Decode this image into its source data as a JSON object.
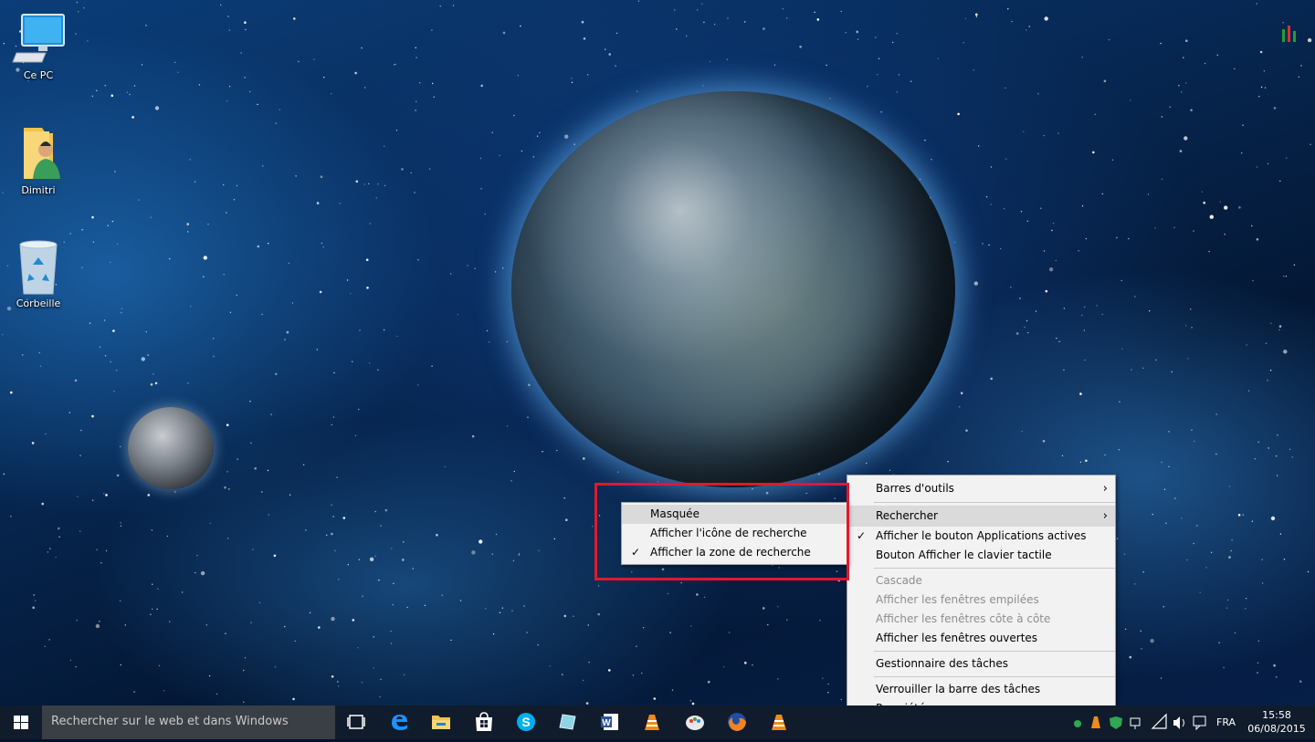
{
  "desktop": {
    "icons": [
      {
        "label": "Ce PC",
        "icon": "computer-icon"
      },
      {
        "label": "Dimitri",
        "icon": "user-folder-icon"
      },
      {
        "label": "Corbeille",
        "icon": "recycle-bin-icon"
      }
    ]
  },
  "taskbar_menu": {
    "items": [
      {
        "label": "Barres d'outils",
        "submenu": true
      },
      {
        "label": "Rechercher",
        "submenu": true,
        "highlighted": true
      },
      {
        "label": "Afficher le bouton Applications actives",
        "checked": true
      },
      {
        "label": "Bouton Afficher le clavier tactile"
      },
      {
        "label": "Cascade",
        "disabled": true
      },
      {
        "label": "Afficher les fenêtres empilées",
        "disabled": true
      },
      {
        "label": "Afficher les fenêtres côte à côte",
        "disabled": true
      },
      {
        "label": "Afficher les fenêtres ouvertes"
      },
      {
        "label": "Gestionnaire des tâches"
      },
      {
        "label": "Verrouiller la barre des tâches"
      },
      {
        "label": "Propriétés"
      }
    ]
  },
  "search_submenu": {
    "items": [
      {
        "label": "Masquée",
        "highlighted": true
      },
      {
        "label": "Afficher l'icône de recherche"
      },
      {
        "label": "Afficher la zone de recherche",
        "checked": true
      }
    ]
  },
  "taskbar": {
    "search_placeholder": "Rechercher sur le web et dans Windows",
    "pinned": [
      "task-view-icon",
      "edge-icon",
      "file-explorer-icon",
      "store-icon",
      "skype-icon",
      "app-icon",
      "word-icon",
      "vlc-icon",
      "paint-icon",
      "firefox-icon",
      "vlc-icon"
    ],
    "language": "FRA",
    "time": "15:58",
    "date": "06/08/2015"
  },
  "colors": {
    "menu_bg": "#f2f2f2",
    "highlight": "#dadada",
    "disabled_text": "#8d8d8d",
    "red_annotation": "#e0192b",
    "taskbar_bg": "#101c2c"
  }
}
